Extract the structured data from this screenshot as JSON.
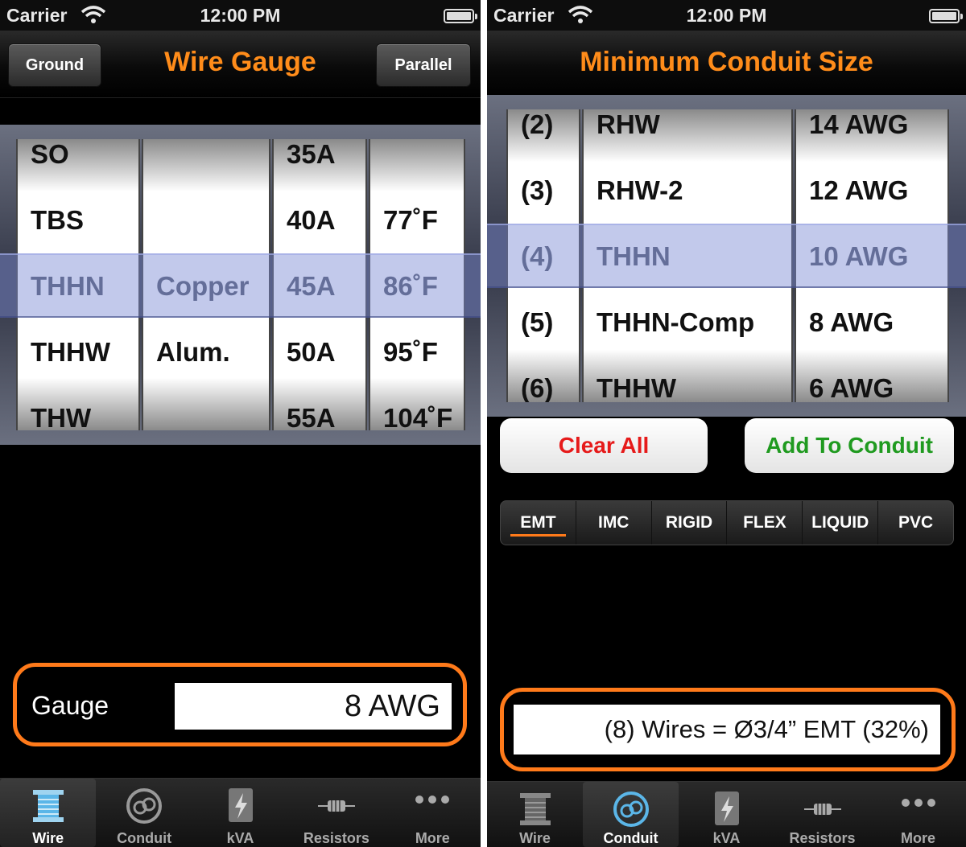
{
  "left": {
    "status": {
      "carrier": "Carrier",
      "time": "12:00 PM"
    },
    "nav": {
      "title": "Wire Gauge",
      "left_button": "Ground",
      "right_button": "Parallel"
    },
    "picker": {
      "col1": [
        "SO",
        "TBS",
        "THHN",
        "THHW",
        "THW"
      ],
      "col2": [
        "",
        "",
        "Copper",
        "Alum.",
        ""
      ],
      "col3": [
        "35A",
        "40A",
        "45A",
        "50A",
        "55A"
      ],
      "col4": [
        "",
        "77˚F",
        "86˚F",
        "95˚F",
        "104˚F"
      ]
    },
    "result": {
      "label": "Gauge",
      "value": "8 AWG"
    },
    "tabs": [
      {
        "label": "Wire",
        "icon": "wire-spool-icon",
        "active": true
      },
      {
        "label": "Conduit",
        "icon": "conduit-icon",
        "active": false
      },
      {
        "label": "kVA",
        "icon": "lightning-icon",
        "active": false
      },
      {
        "label": "Resistors",
        "icon": "resistor-icon",
        "active": false
      },
      {
        "label": "More",
        "icon": "more-dots-icon",
        "active": false
      }
    ]
  },
  "right": {
    "status": {
      "carrier": "Carrier",
      "time": "12:00 PM"
    },
    "nav": {
      "title": "Minimum Conduit Size"
    },
    "picker": {
      "col1": [
        "(2)",
        "(3)",
        "(4)",
        "(5)",
        "(6)"
      ],
      "col2": [
        "RHW",
        "RHW-2",
        "THHN",
        "THHN-Comp",
        "THHW"
      ],
      "col3": [
        "14 AWG",
        "12 AWG",
        "10 AWG",
        "8 AWG",
        "6 AWG"
      ]
    },
    "buttons": {
      "clear": "Clear All",
      "add": "Add To Conduit"
    },
    "segments": [
      "EMT",
      "IMC",
      "RIGID",
      "FLEX",
      "LIQUID",
      "PVC"
    ],
    "active_segment": "EMT",
    "result": "(8) Wires = Ø3/4” EMT (32%)",
    "tabs": [
      {
        "label": "Wire",
        "icon": "wire-spool-icon",
        "active": false
      },
      {
        "label": "Conduit",
        "icon": "conduit-icon",
        "active": true
      },
      {
        "label": "kVA",
        "icon": "lightning-icon",
        "active": false
      },
      {
        "label": "Resistors",
        "icon": "resistor-icon",
        "active": false
      },
      {
        "label": "More",
        "icon": "more-dots-icon",
        "active": false
      }
    ]
  },
  "colors": {
    "accent": "#ff8c1a",
    "clear": "#e61a1a",
    "add": "#1f9a1f",
    "selection": "#7887d2"
  }
}
